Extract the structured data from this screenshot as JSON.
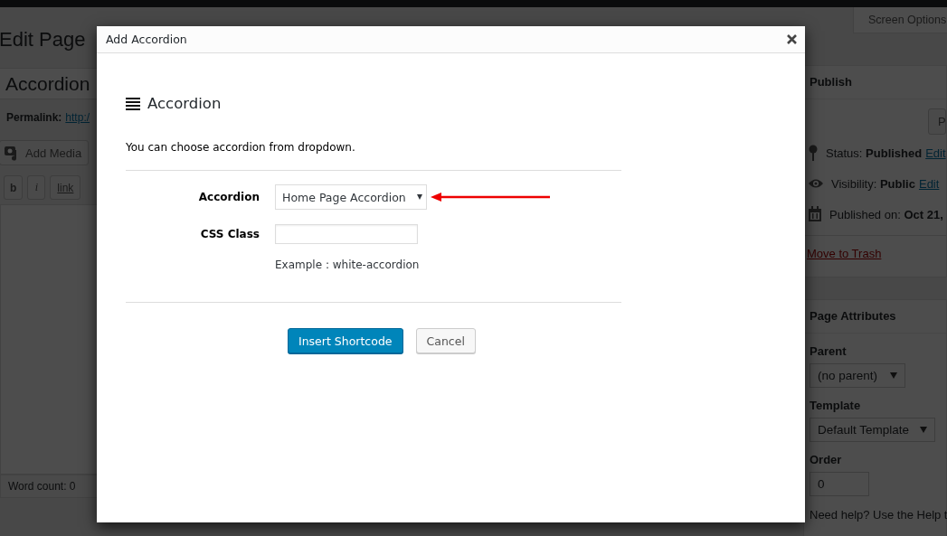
{
  "page": {
    "heading": "Edit Page",
    "screen_options": "Screen Options",
    "title_value": "Accordion",
    "permalink_label": "Permalink:",
    "permalink_link": "http:/",
    "add_media": "Add Media",
    "format_buttons": [
      {
        "label": "b",
        "kind": "bold"
      },
      {
        "label": "i",
        "kind": "italic"
      },
      {
        "label": "link",
        "kind": "link"
      }
    ],
    "word_count": "Word count: 0"
  },
  "sidebar": {
    "publish": {
      "title": "Publish",
      "button": "P",
      "rows": [
        {
          "kind": "status",
          "label": "Status:",
          "value": "Published",
          "link": "Edit"
        },
        {
          "kind": "visibility",
          "label": "Visibility:",
          "value": "Public",
          "link": "Edit"
        },
        {
          "kind": "date",
          "label": "Published on:",
          "value": "Oct 21,"
        }
      ],
      "trash": "Move to Trash"
    },
    "page_attributes": {
      "title": "Page Attributes",
      "fields": [
        {
          "label": "Parent",
          "kind": "select",
          "value": "(no parent)"
        },
        {
          "label": "Template",
          "kind": "select",
          "value": "Default Template"
        },
        {
          "label": "Order",
          "kind": "input",
          "value": "0"
        }
      ],
      "help": "Need help? Use the Help t"
    }
  },
  "dialog": {
    "title": "Add Accordion",
    "heading": "Accordion",
    "description": "You can choose accordion from dropdown.",
    "fields": [
      {
        "label": "Accordion",
        "kind": "select",
        "value": "Home Page Accordion"
      },
      {
        "label": "CSS Class",
        "kind": "input"
      }
    ],
    "example": "Example : white-accordion",
    "buttons": [
      {
        "label": "Insert Shortcode",
        "kind": "primary"
      },
      {
        "label": "Cancel",
        "kind": "secondary"
      }
    ]
  }
}
